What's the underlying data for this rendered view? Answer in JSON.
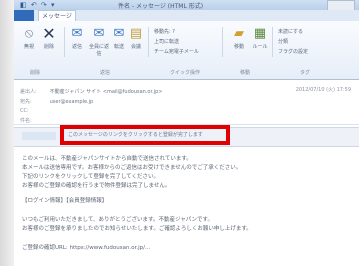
{
  "window": {
    "title": "件名 - メッセージ (HTML 形式)",
    "quick_icons": "◧ ↶ ↷ ▾"
  },
  "tabs": {
    "message": "メッセージ"
  },
  "ribbon": {
    "ignore_label": "無視",
    "delete_label": "削除",
    "reply_label": "返信",
    "reply_all_label": "全員に返信",
    "forward_label": "転送",
    "meeting_label": "会議",
    "quick_steps": [
      "移動先: ?",
      "上司に転送",
      "チーム宛電子メール"
    ],
    "move_label": "移動",
    "rules_label": "ルール",
    "mark_unread_label": "未読にする",
    "categorize_label": "分類",
    "followup_label": "フラグの設定",
    "groups": [
      "削除",
      "返信",
      "クイック操作",
      "移動",
      "タグ"
    ]
  },
  "header": {
    "from_label": "差出人:",
    "from_value": "不動産ジャパン サイト <mail@fudousan.or.jp>",
    "to_label": "宛先:",
    "to_value": "user@example.jp",
    "cc_label": "CC:",
    "subject_label": "件名:",
    "date_value": "2012/07/10 (火) 17:59"
  },
  "infobar": {
    "text": "このメッセージのリンクをクリックすると登録が完了します"
  },
  "body": {
    "lines": [
      "このメールは、不動産ジャパンサイトから自動で送信されています。",
      "本メールは送信専用です。お客様からのご返信はお受けできませんのでご了承ください。",
      "下記のリンクをクリックして登録を完了してください。",
      "お客様のご登録の確認を行うまで物件登録は完了しません。",
      "",
      "【ログイン情報】【会員登録情報】",
      "",
      "いつもご利用いただきまして、ありがとうございます。不動産ジャパンです。",
      "お客様のご登録を承りましたのでお知らせいたします。ご確認よろしくお願い申し上げます。",
      "",
      "ご登録の確認URL: https://www.fudousan.or.jp/..."
    ]
  }
}
